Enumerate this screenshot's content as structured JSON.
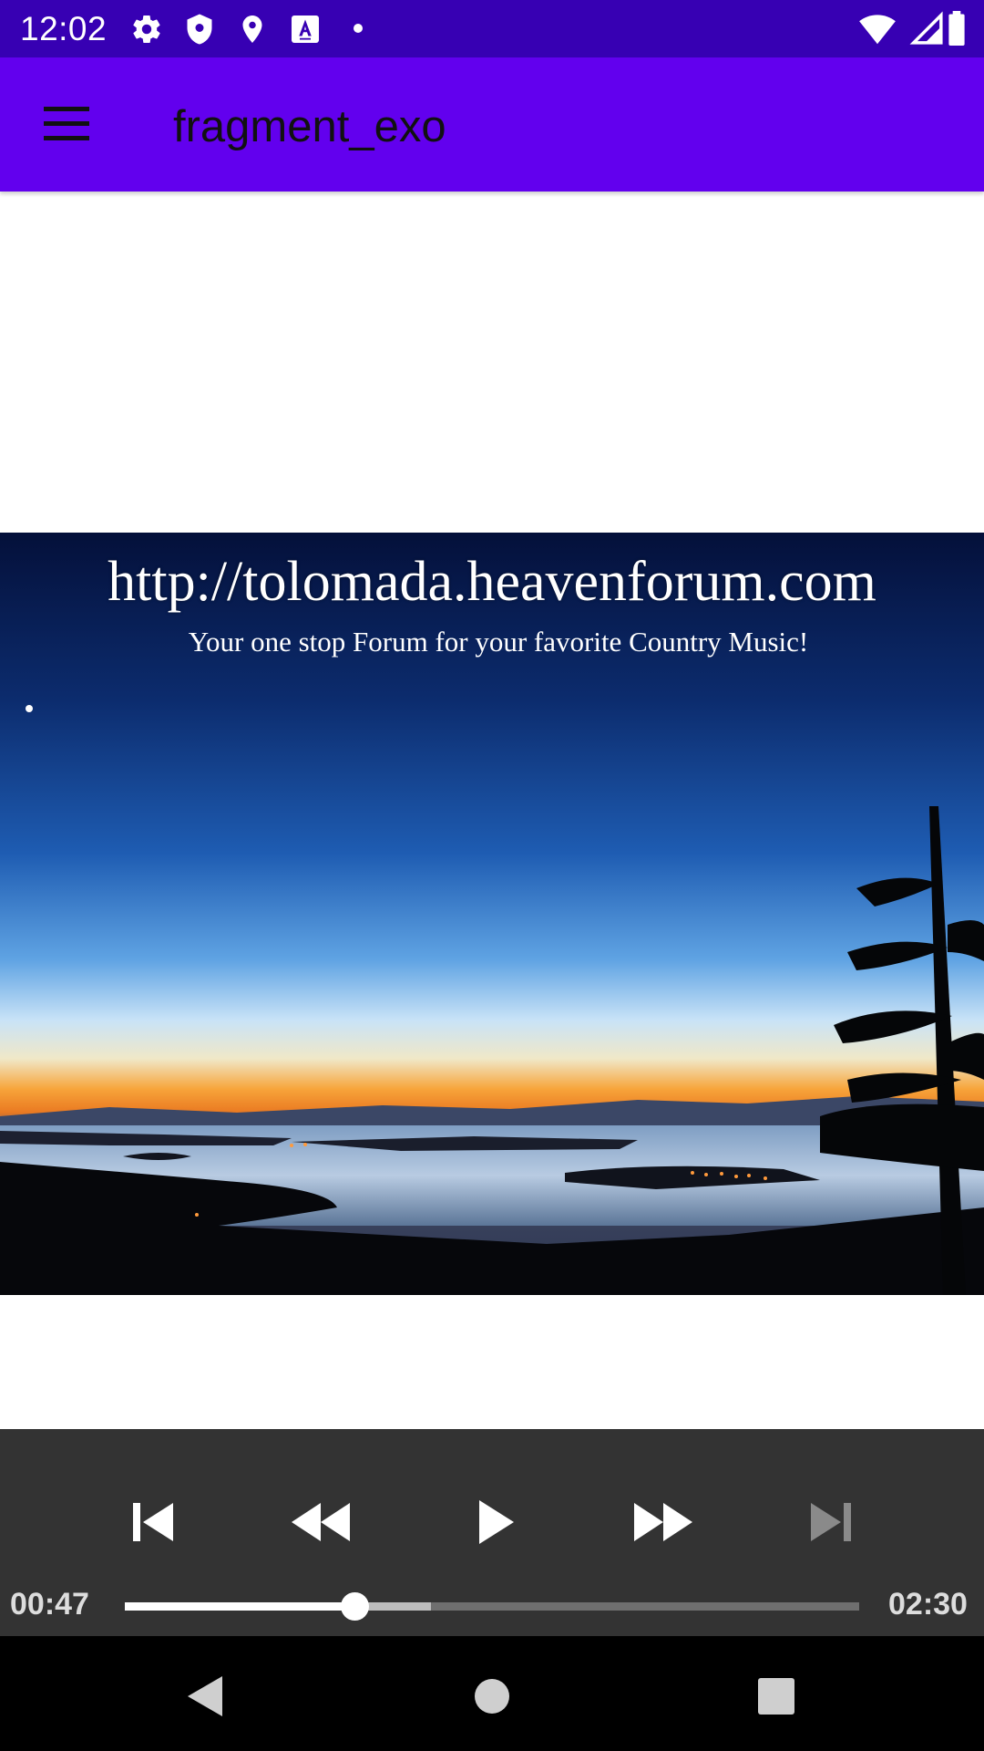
{
  "status_bar": {
    "time": "12:02",
    "icons": [
      "settings-icon",
      "shield-icon",
      "location-icon",
      "text-a-icon",
      "dot-icon",
      "wifi-icon",
      "signal-icon",
      "battery-icon"
    ]
  },
  "app_bar": {
    "title": "fragment_exo",
    "menu_icon": "hamburger-menu-icon",
    "background": "#6200ee",
    "status_background": "#3700b3"
  },
  "video": {
    "overlay_url": "http://tolomada.heavenforum.com",
    "overlay_tagline": "Your one stop Forum for your favorite Country Music!"
  },
  "player": {
    "position": "00:47",
    "duration": "02:30",
    "played_fraction": 0.313,
    "buffered_fraction": 0.417,
    "buttons": [
      "skip-previous-icon",
      "rewind-icon",
      "play-icon",
      "fast-forward-icon",
      "skip-next-icon"
    ],
    "skip_next_enabled": false
  },
  "nav_bar": {
    "buttons": [
      "back-icon",
      "home-icon",
      "recents-icon"
    ]
  }
}
